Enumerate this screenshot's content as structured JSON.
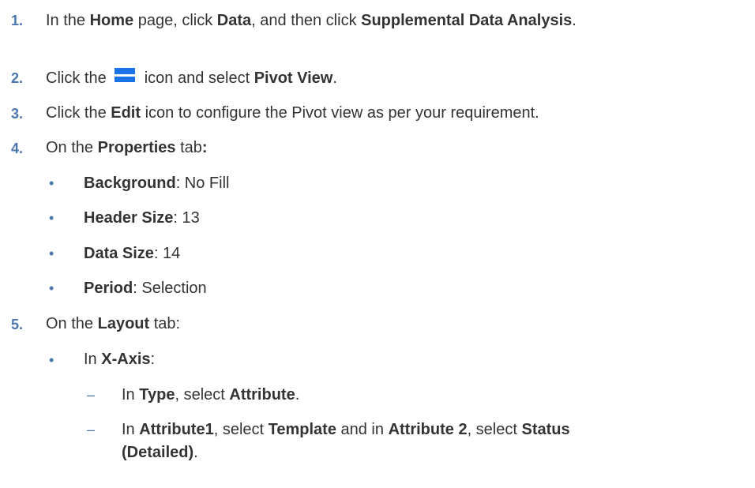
{
  "steps": [
    {
      "num": "1.",
      "parts": [
        "In the ",
        "Home",
        " page, click ",
        "Data",
        ", and then click ",
        "Supplemental Data Analysis",
        "."
      ]
    },
    {
      "num": "2.",
      "parts": [
        "Click the",
        "icon and select ",
        "Pivot View",
        "."
      ],
      "icon": "hamburger-menu-icon"
    },
    {
      "num": "3.",
      "parts": [
        "Click the ",
        "Edit",
        " icon to configure the Pivot view as per your requirement."
      ]
    },
    {
      "num": "4.",
      "parts": [
        "On the ",
        "Properties",
        " tab",
        ":"
      ],
      "bullets": [
        {
          "label": "Background",
          "value": ": No Fill"
        },
        {
          "label": "Header Size",
          "value": ": 13"
        },
        {
          "label": "Data Size",
          "value": ": 14"
        },
        {
          "label": "Period",
          "value": ": Selection"
        }
      ]
    },
    {
      "num": "5.",
      "parts": [
        "On the ",
        "Layout",
        " tab:"
      ],
      "bullet": {
        "pre": "In ",
        "label": "X-Axis",
        "post": ":"
      },
      "sub": [
        [
          "In ",
          "Type",
          ", select ",
          "Attribute",
          "."
        ],
        [
          "In ",
          "Attribute1",
          ", select ",
          "Template",
          " and in ",
          "Attribute 2",
          ", select ",
          "Status"
        ],
        [
          "(Detailed)",
          "."
        ]
      ]
    }
  ],
  "bullet_char": "•",
  "dash_char": "–",
  "colors": {
    "accent": "#4a76b0",
    "icon": "#1a73e8",
    "text": "#333333"
  }
}
